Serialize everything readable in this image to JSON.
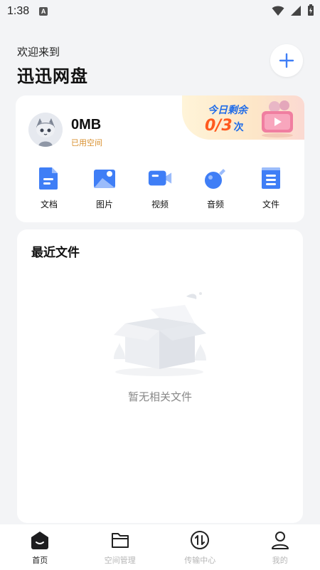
{
  "status_bar": {
    "time": "1:38",
    "notification": "A"
  },
  "header": {
    "welcome": "欢迎来到",
    "title": "迅迅网盘"
  },
  "quota": {
    "label": "今日剩余",
    "value": "0/3",
    "unit": "次"
  },
  "storage": {
    "used": "0MB",
    "label": "已用空间"
  },
  "categories": [
    {
      "label": "文档",
      "icon": "document-icon"
    },
    {
      "label": "图片",
      "icon": "image-icon"
    },
    {
      "label": "视频",
      "icon": "video-icon"
    },
    {
      "label": "音频",
      "icon": "audio-icon"
    },
    {
      "label": "文件",
      "icon": "file-icon"
    }
  ],
  "recent": {
    "title": "最近文件",
    "empty_text": "暂无相关文件"
  },
  "tabbar": [
    {
      "label": "首页",
      "icon": "home-icon",
      "active": true
    },
    {
      "label": "空间管理",
      "icon": "folder-icon",
      "active": false
    },
    {
      "label": "传输中心",
      "icon": "transfer-icon",
      "active": false
    },
    {
      "label": "我的",
      "icon": "profile-icon",
      "active": false
    }
  ],
  "colors": {
    "accent": "#1f6be8",
    "quota_highlight": "#ff5a1f",
    "storage_label": "#d9902f",
    "icon_blue": "#3f7ef6"
  }
}
